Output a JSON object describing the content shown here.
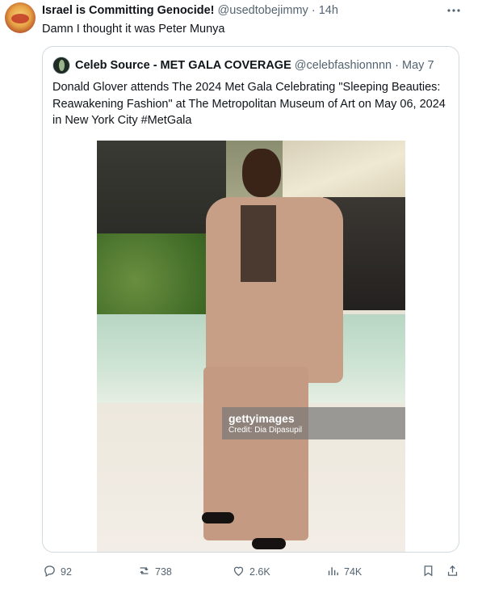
{
  "tweet": {
    "author_name": "Israel is Committing Genocide!",
    "author_handle": "@usedtobejimmy",
    "separator": "·",
    "time": "14h",
    "text": "Damn I thought it was Peter Munya"
  },
  "quote": {
    "author_name": "Celeb Source - MET GALA COVERAGE",
    "author_handle": "@celebfashionnnn",
    "separator": "·",
    "time": "May 7",
    "text": "Donald Glover attends The 2024 Met Gala Celebrating \"Sleeping Beauties: Reawakening Fashion\" at The Metropolitan Museum of Art on May 06, 2024 in New York City #MetGala",
    "watermark": {
      "brand": "gettyimages",
      "credit": "Credit: Dia Dipasupil"
    }
  },
  "actions": {
    "replies": "92",
    "retweets": "738",
    "likes": "2.6K",
    "views": "74K"
  },
  "icons": [
    "more-icon",
    "reply-icon",
    "retweet-icon",
    "like-icon",
    "views-icon",
    "bookmark-icon",
    "share-icon"
  ],
  "colors": {
    "muted": "#536471",
    "text": "#0f1419",
    "border": "#cfd9de"
  }
}
